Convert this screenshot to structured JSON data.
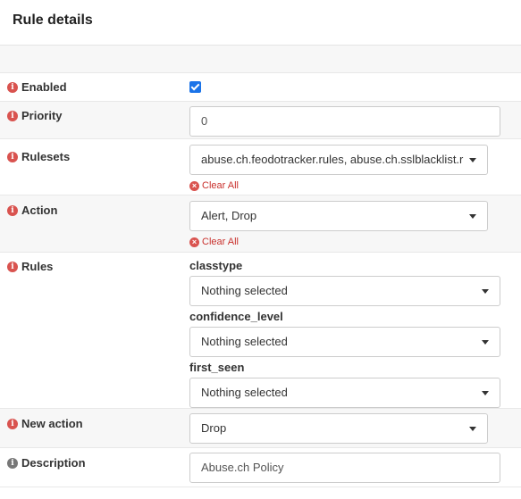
{
  "header": {
    "title": "Rule details"
  },
  "fields": {
    "enabled": {
      "label": "Enabled",
      "checked": true
    },
    "priority": {
      "label": "Priority",
      "value": "0"
    },
    "rulesets": {
      "label": "Rulesets",
      "value": "abuse.ch.feodotracker.rules, abuse.ch.sslblacklist.r",
      "clear_label": "Clear All"
    },
    "action": {
      "label": "Action",
      "value": "Alert, Drop",
      "clear_label": "Clear All"
    },
    "rules": {
      "label": "Rules",
      "classtype": {
        "label": "classtype",
        "value": "Nothing selected"
      },
      "confidence_level": {
        "label": "confidence_level",
        "value": "Nothing selected"
      },
      "first_seen": {
        "label": "first_seen",
        "value": "Nothing selected"
      }
    },
    "new_action": {
      "label": "New action",
      "value": "Drop"
    },
    "description": {
      "label": "Description",
      "value": "Abuse.ch Policy"
    }
  },
  "colors": {
    "info_icon": "#d9534f",
    "checkbox": "#1a73e8",
    "clear_all": "#c9302c"
  }
}
